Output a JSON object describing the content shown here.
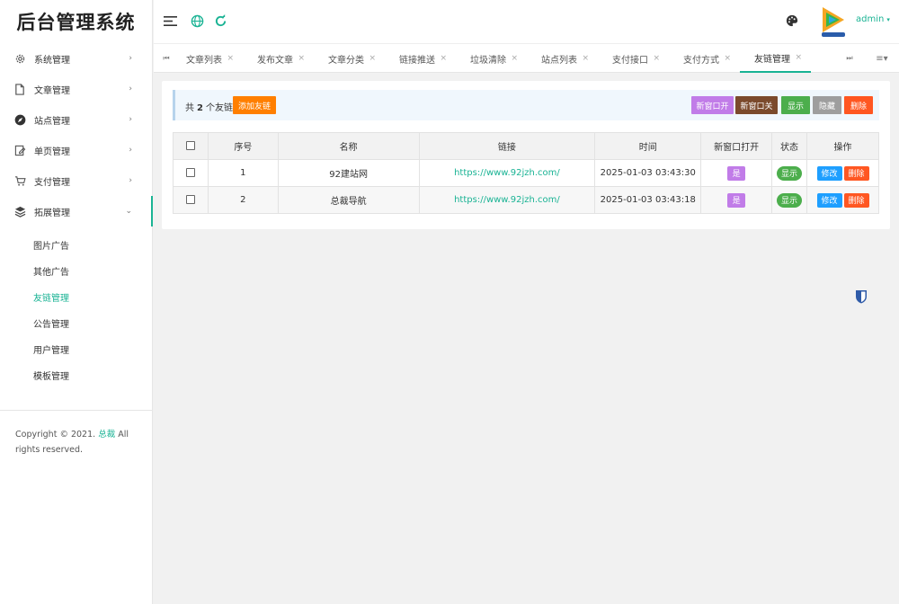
{
  "app": {
    "title": "后台管理系统"
  },
  "sidebar": {
    "items": [
      {
        "label": "系统管理",
        "icon": "gear-icon"
      },
      {
        "label": "文章管理",
        "icon": "document-icon"
      },
      {
        "label": "站点管理",
        "icon": "compass-icon"
      },
      {
        "label": "单页管理",
        "icon": "page-edit-icon"
      },
      {
        "label": "支付管理",
        "icon": "cart-icon"
      },
      {
        "label": "拓展管理",
        "icon": "layers-icon"
      }
    ],
    "subitems": [
      "图片广告",
      "其他广告",
      "友链管理",
      "公告管理",
      "用户管理",
      "模板管理"
    ],
    "arrow_right": "›",
    "arrow_down": "⌄"
  },
  "footer": {
    "copyright_prefix": "Copyright © 2021.",
    "link": "总裁",
    "copyright_suffix": "All rights reserved."
  },
  "header": {
    "user": "admin",
    "caret": "▾"
  },
  "tabs": {
    "first_icon": "⏮",
    "last_icon": "⏭",
    "menu_icon": "≡▾",
    "close": "×",
    "items": [
      "文章列表",
      "发布文章",
      "文章分类",
      "链接推送",
      "垃圾清除",
      "站点列表",
      "支付接口",
      "支付方式",
      "友链管理"
    ]
  },
  "toolbar": {
    "count_prefix": "共",
    "count": "2",
    "count_suffix": "个友链",
    "add_button": "添加友链",
    "buttons": [
      {
        "label": "新窗口开",
        "color": "#c17ce8"
      },
      {
        "label": "新窗口关",
        "color": "#7b4a2c"
      },
      {
        "label": "显示",
        "color": "#4cae4c"
      },
      {
        "label": "隐藏",
        "color": "#9e9e9e"
      },
      {
        "label": "删除",
        "color": "#ff5722"
      }
    ]
  },
  "table": {
    "headers": [
      "序号",
      "名称",
      "链接",
      "时间",
      "新窗口打开",
      "状态",
      "操作"
    ],
    "rows": [
      {
        "id": "1",
        "name": "92建站网",
        "url": "https://www.92jzh.com/",
        "time": "2025-01-03 03:43:30",
        "newwin": "是",
        "status": "显示",
        "edit": "修改",
        "delete": "删除"
      },
      {
        "id": "2",
        "name": "总裁导航",
        "url": "https://www.92jzh.com/",
        "time": "2025-01-03 03:43:18",
        "newwin": "是",
        "status": "显示",
        "edit": "修改",
        "delete": "删除"
      }
    ]
  },
  "colors": {
    "accent": "#1ab394",
    "add": "#ff7f00",
    "edit": "#1e9fff",
    "delete": "#ff5722"
  }
}
